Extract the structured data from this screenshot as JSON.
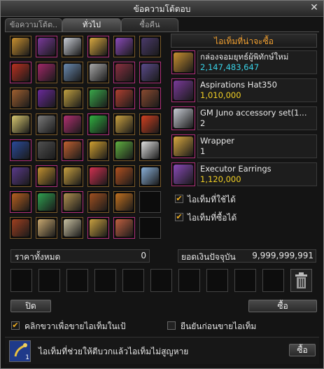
{
  "window": {
    "title": "ข้อความโต้ตอบ",
    "close_glyph": "✕"
  },
  "tabs": [
    {
      "label": "ข้อความโต้ต..",
      "active": false
    },
    {
      "label": "ทั่วไป",
      "active": true
    },
    {
      "label": "ซื้อคืน",
      "active": false
    }
  ],
  "shop_panel": {
    "title": "ไอเท็มที่น่าจะซื้อ",
    "items": [
      {
        "name": "กล่องจอมยุทธ์ผู้พิทักษ์ใหม่",
        "price": "2,147,483,647",
        "price_color": "#39d1e6",
        "icon": "treasure-chest-icon"
      },
      {
        "name": "Aspirations Hat350",
        "price": "1,010,000",
        "price_color": "#f2d024",
        "icon": "hat-icon"
      },
      {
        "name": "GM Juno accessory set(1...",
        "price": "2",
        "price_color": "#e8e8e8",
        "icon": "gift-box-icon"
      },
      {
        "name": "Wrapper",
        "price": "1",
        "price_color": "#e8e8e8",
        "icon": "scroll-icon"
      },
      {
        "name": "Executor Earrings",
        "price": "1,120,000",
        "price_color": "#f2d024",
        "icon": "earrings-icon"
      }
    ],
    "filter_usable": {
      "label": "ไอเท็มที่ใช้ได้",
      "checked": true
    },
    "filter_buyable": {
      "label": "ไอเท็มที่ซื้อได้",
      "checked": true
    }
  },
  "totals": {
    "total_price_label": "ราคาทั้งหมด",
    "total_price_value": "0",
    "balance_label": "ยอดเงินปัจจุบัน",
    "balance_value": "9,999,999,991"
  },
  "buttons": {
    "close_label": "ปิด",
    "buy_label": "ซื้อ",
    "bottom_buy_label": "ซื้อ"
  },
  "options": {
    "right_click_sell": {
      "label": "คลิกขวาเพื่อขายไอเท็มในเป้",
      "checked": true
    },
    "confirm_before_sell": {
      "label": "ยืนยันก่อนขายไอเท็ม",
      "checked": false
    }
  },
  "bottom_bar": {
    "text": "ไอเท็มที่ช่วยให้ตีบวกแล้วไอเท็มไม่สูญหาย",
    "icon": "protection-scroll-icon",
    "count": "1"
  },
  "grid_items": [
    {
      "icon": "chest-icon",
      "color": "#c89030"
    },
    {
      "icon": "hat-icon",
      "color": "#7a3a9a"
    },
    {
      "icon": "gift-box-icon",
      "color": "#c8ccd4"
    },
    {
      "icon": "scroll-icon",
      "color": "#d8a840"
    },
    {
      "icon": "earrings-icon",
      "color": "#8a4ab8"
    },
    {
      "icon": "wings-icon",
      "color": "#4a3a6a"
    },
    {
      "icon": "exp-badge-icon",
      "color": "#b83020"
    },
    {
      "icon": "armor-icon",
      "color": "#a02868"
    },
    {
      "icon": "gift-6h-icon",
      "color": "#6a8ab0"
    },
    {
      "icon": "line-fist-icon",
      "color": "#a8a8a8"
    },
    {
      "icon": "sword-icon",
      "color": "#8a3040"
    },
    {
      "icon": "staff-icon",
      "color": "#5a4a8a"
    },
    {
      "icon": "tome-icon",
      "color": "#a06030"
    },
    {
      "icon": "cape-icon",
      "color": "#6a2a9a"
    },
    {
      "icon": "present-icon",
      "color": "#c0a040"
    },
    {
      "icon": "shield-icon",
      "color": "#3aa84a"
    },
    {
      "icon": "necklace-icon",
      "color": "#b04030"
    },
    {
      "icon": "dagger-icon",
      "color": "#8a4a30"
    },
    {
      "icon": "coin-icon",
      "color": "#d8c870"
    },
    {
      "icon": "dg-badge-icon",
      "color": "#7a7a7a"
    },
    {
      "icon": "candy-icon",
      "color": "#b03070"
    },
    {
      "icon": "gem-icon",
      "color": "#30b040"
    },
    {
      "icon": "ring-icon",
      "color": "#c8a040"
    },
    {
      "icon": "wow-card-icon",
      "color": "#d04020"
    },
    {
      "icon": "card-icon",
      "color": "#2a4a9a"
    },
    {
      "icon": "glove-icon",
      "color": "#505050"
    },
    {
      "icon": "orb-icon",
      "color": "#c06030"
    },
    {
      "icon": "medal-icon",
      "color": "#d0a030"
    },
    {
      "icon": "wand-icon",
      "color": "#60b040"
    },
    {
      "icon": "ticket-icon",
      "color": "#e0e0e0"
    },
    {
      "icon": "bow-icon",
      "color": "#5a3a8a"
    },
    {
      "icon": "blade-icon",
      "color": "#c09030"
    },
    {
      "icon": "cdm-box-icon",
      "color": "#c8a040"
    },
    {
      "icon": "potion-icon",
      "color": "#d03050"
    },
    {
      "icon": "spear-icon",
      "color": "#b05020"
    },
    {
      "icon": "voucher-icon",
      "color": "#8ab0d8"
    },
    {
      "icon": "fan-icon",
      "color": "#b86020"
    },
    {
      "icon": "green-box-icon",
      "color": "#30a050"
    },
    {
      "icon": "dg-crate-icon",
      "color": "#b09050"
    },
    {
      "icon": "bracelet-icon",
      "color": "#a05020"
    },
    {
      "icon": "axe-icon",
      "color": "#c07020"
    },
    {
      "icon": "",
      "color": ""
    },
    {
      "icon": "rod-icon",
      "color": "#a04020"
    },
    {
      "icon": "wood-box-icon",
      "color": "#c8a870"
    },
    {
      "icon": "emblem-icon",
      "color": "#c8c0a0"
    },
    {
      "icon": "trophy-icon",
      "color": "#c8a040"
    },
    {
      "icon": "mace-icon",
      "color": "#c06040"
    },
    {
      "icon": "",
      "color": ""
    }
  ]
}
